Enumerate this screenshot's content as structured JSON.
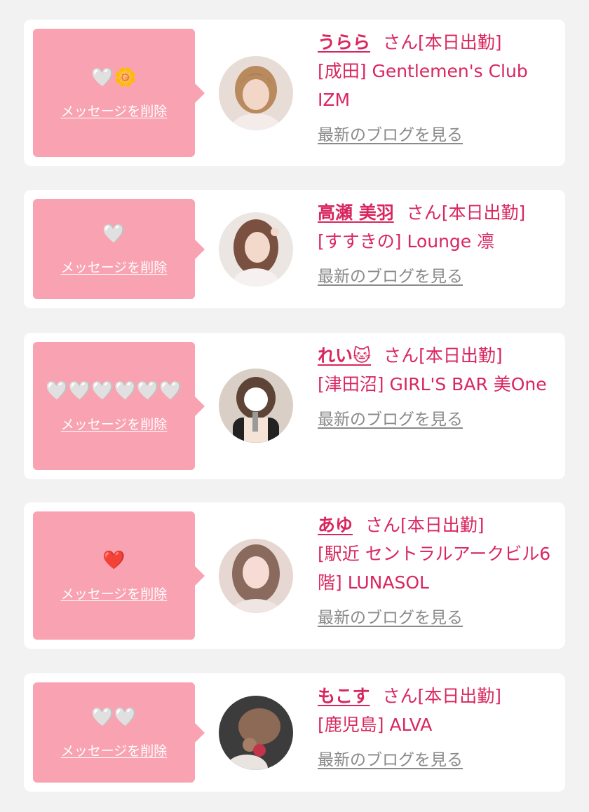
{
  "delete_label": "メッセージを削除",
  "blog_label": "最新のブログを見る",
  "colors": {
    "background": "#f2f2f2",
    "card": "#ffffff",
    "bubble": "#f9a3b2",
    "accent": "#d9265f",
    "link_gray": "#8a8a8a"
  },
  "items": [
    {
      "name": "うらら",
      "status": "さん[本日出勤]",
      "shop": "[成田] Gentlemen's Club IZM",
      "reaction": "🤍🌼",
      "avatar_icon": "profile-photo-icon"
    },
    {
      "name": "高瀬 美羽",
      "status": "さん[本日出勤]",
      "shop": "[すすきの] Lounge 凛",
      "reaction": "🤍",
      "avatar_icon": "profile-photo-icon"
    },
    {
      "name": "れい🐱",
      "status": "さん[本日出勤]",
      "shop": "[津田沼] GIRL'S BAR 美One",
      "reaction": "🤍🤍🤍🤍🤍🤍",
      "avatar_icon": "profile-photo-icon"
    },
    {
      "name": "あゆ",
      "status": "さん[本日出勤]",
      "shop": "[駅近 セントラルアークビル6階] LUNASOL",
      "reaction": "❤️",
      "avatar_icon": "profile-photo-icon"
    },
    {
      "name": "もこす",
      "status": "さん[本日出勤]",
      "shop": "[鹿児島] ALVA",
      "reaction": "🤍🤍",
      "avatar_icon": "profile-photo-icon"
    }
  ]
}
